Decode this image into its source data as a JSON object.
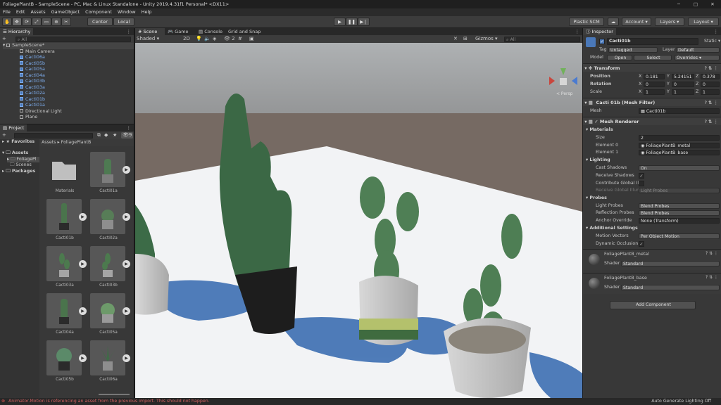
{
  "title_bar": {
    "title": "FoliagePlantB - SampleScene - PC, Mac & Linux Standalone - Unity 2019.4.31f1 Personal* <DX11>",
    "controls": [
      "─",
      "□",
      "✕"
    ]
  },
  "menu": [
    "File",
    "Edit",
    "Assets",
    "GameObject",
    "Component",
    "Window",
    "Help"
  ],
  "toolbar": {
    "pivot": "Center",
    "space": "Local",
    "plastic": "Plastic SCM",
    "account": "Account",
    "layers": "Layers",
    "layout": "Layout"
  },
  "hierarchy": {
    "tab": "Hierarchy",
    "add": "+",
    "search_placeholder": "All",
    "scene": "SampleScene*",
    "items": [
      "Main Camera",
      "Cacti06a",
      "Cacti05b",
      "Cacti05a",
      "Cacti04a",
      "Cacti03b",
      "Cacti03a",
      "Cacti02a",
      "Cacti01b",
      "Cacti01a",
      "Directional Light",
      "Plane"
    ]
  },
  "project": {
    "tab": "Project",
    "add": "+",
    "favorites": "Favorites",
    "tree": [
      "Assets",
      "FoliagePl",
      "Scenes",
      "Packages"
    ],
    "breadcrumb": [
      "Assets",
      "FoliagePlantB"
    ],
    "badge": "9",
    "assets": [
      "Materials",
      "Cacti01a",
      "Cacti01b",
      "Cacti02a",
      "Cacti03a",
      "Cacti03b",
      "Cacti04a",
      "Cacti05a",
      "Cacti05b",
      "Cacti06a"
    ]
  },
  "scene_view": {
    "tabs": [
      "Scene",
      "Game",
      "Console",
      "Grid and Snap"
    ],
    "shading": "Shaded",
    "mode2d": "2D",
    "gizmos": "Gizmos",
    "search_placeholder": "All",
    "hidden_count": "2",
    "persp": "< Persp"
  },
  "inspector": {
    "tab": "Inspector",
    "object_name": "Cacti01b",
    "static": "Static",
    "tag_label": "Tag",
    "tag": "Untagged",
    "layer_label": "Layer",
    "layer": "Default",
    "model_label": "Model",
    "open": "Open",
    "select": "Select",
    "overrides": "Overrides",
    "transform": {
      "title": "Transform",
      "position_label": "Position",
      "position": {
        "x": "0.181",
        "y": "5.24151",
        "z": "0.378"
      },
      "rotation_label": "Rotation",
      "rotation": {
        "x": "0",
        "y": "0",
        "z": "0"
      },
      "scale_label": "Scale",
      "scale": {
        "x": "1",
        "y": "1",
        "z": "1"
      }
    },
    "mesh_filter": {
      "title": "Cacti 01b (Mesh Filter)",
      "mesh_label": "Mesh",
      "mesh": "Cacti01b"
    },
    "mesh_renderer": {
      "title": "Mesh Renderer",
      "materials": "Materials",
      "size_label": "Size",
      "size": "2",
      "elements": [
        {
          "label": "Element 0",
          "value": "FoliagePlantB_metal"
        },
        {
          "label": "Element 1",
          "value": "FoliagePlantB_base"
        }
      ],
      "lighting": "Lighting",
      "cast_shadows_label": "Cast Shadows",
      "cast_shadows": "On",
      "receive_shadows": "Receive Shadows",
      "contribute_gi": "Contribute Global Illu",
      "receive_gi_label": "Receive Global Illum",
      "receive_gi": "Light Probes",
      "probes": "Probes",
      "light_probes_label": "Light Probes",
      "light_probes": "Blend Probes",
      "reflection_probes_label": "Reflection Probes",
      "reflection_probes": "Blend Probes",
      "anchor_label": "Anchor Override",
      "anchor": "None (Transform)",
      "additional": "Additional Settings",
      "motion_label": "Motion Vectors",
      "motion": "Per Object Motion",
      "occlusion": "Dynamic Occlusion"
    },
    "materials": [
      {
        "name": "FoliagePlantB_metal",
        "shader_label": "Shader",
        "shader": "Standard"
      },
      {
        "name": "FoliagePlantB_base",
        "shader_label": "Shader",
        "shader": "Standard"
      }
    ],
    "add_component": "Add Component"
  },
  "status": {
    "message": "Animator.Motion is referencing an asset from the previous import. This should not happen.",
    "right": "Auto Generate Lighting Off"
  },
  "colors": {
    "accent": "#4a78b8",
    "status_error": "#d9534f",
    "sky": "#a0a3a6",
    "ground": "#776962"
  }
}
